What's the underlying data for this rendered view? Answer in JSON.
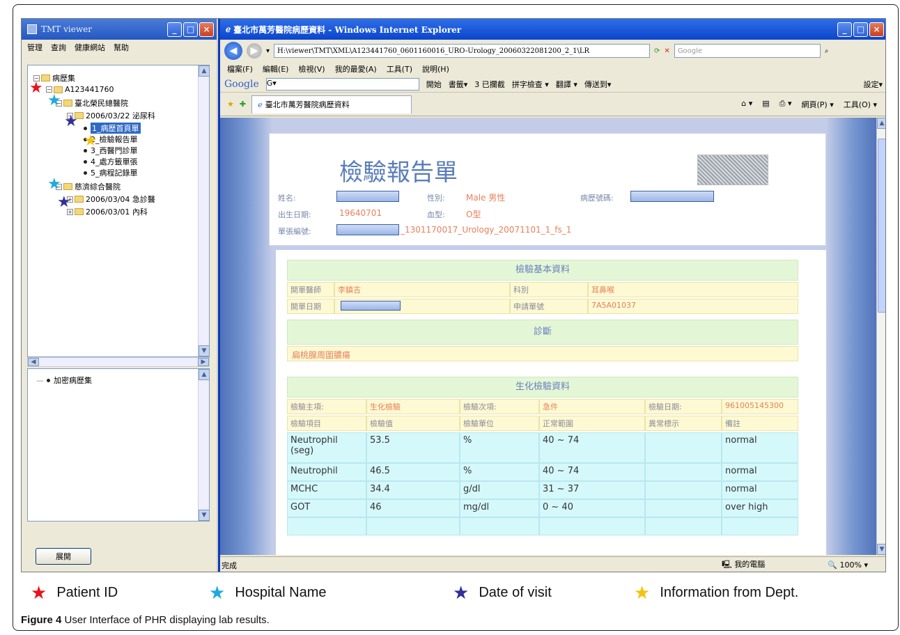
{
  "tmt": {
    "title": "TMT viewer",
    "menu": [
      "管理",
      "查詢",
      "健康網站",
      "幫助"
    ],
    "tree": {
      "root": "病歷集",
      "patient": "A123441760",
      "hospital1": "臺北榮民總醫院",
      "visit1": "2006/03/22 泌尿科",
      "docs": [
        "1_病歷首頁單",
        "2_檢驗報告單",
        "3_西醫門診單",
        "4_處方籤單張",
        "5_病程記錄單"
      ],
      "hospital2": "慈濟綜合醫院",
      "visit2": "2006/03/04 急診醫",
      "visit3": "2006/03/01 內科"
    },
    "lower_item": "加密病歷集",
    "expand_button": "展開"
  },
  "ie": {
    "title": "臺北市萬芳醫院病歷資料 - Windows Internet Explorer",
    "address": "H:\\viewer\\TMT\\XML\\A123441760_0601160016_URO-Urology_20060322081200_2_1\\LR",
    "search_placeholder": "Google",
    "menu": [
      "檔案(F)",
      "編輯(E)",
      "檢視(V)",
      "我的最愛(A)",
      "工具(T)",
      "說明(H)"
    ],
    "google_bar": {
      "logo": "Google",
      "g_box": "G▾",
      "items": [
        "開始",
        "書籤▾",
        "3 已攔截",
        "拼字檢查 ▾",
        "翻譯 ▾",
        "傳送到▾",
        "設定▾"
      ]
    },
    "tab_label": "臺北市萬芳醫院病歷資料",
    "tools": [
      "網頁(P) ▾",
      "工具(O) ▾"
    ],
    "status_left": "完成",
    "status_zone": "我的電腦",
    "status_zoom": "100%"
  },
  "report": {
    "title": "檢驗報告單",
    "fields": {
      "name_label": "姓名:",
      "sex_label": "性別:",
      "sex_value": "Male 男性",
      "chart_label": "病歷號碼:",
      "birth_label": "出生日期:",
      "birth_value": "19640701",
      "blood_label": "血型:",
      "blood_value": "O型",
      "form_label": "單張編號:",
      "form_value": "_1301170017_Urology_20071101_1_fs_1"
    },
    "basic": {
      "header": "檢驗基本資料",
      "doctor_label": "開單醫師",
      "doctor_value": "李鎮吉",
      "dept_label": "科別",
      "dept_value": "耳鼻喉",
      "date_label": "開單日期",
      "apply_label": "申請單號",
      "apply_value": "7A5A01037"
    },
    "diagnosis": {
      "header": "診斷",
      "value": "扁桃腺周圍膿瘍"
    },
    "bio": {
      "header": "生化檢驗資料",
      "meta": [
        "檢驗主項:",
        "生化檢驗",
        "檢驗次項:",
        "急件",
        "檢驗日期:",
        "961005145300"
      ],
      "columns": [
        "檢驗項目",
        "檢驗值",
        "檢驗單位",
        "正常範圍",
        "異常標示",
        "備註"
      ],
      "rows": [
        [
          "Neutrophil (seg)",
          "53.5",
          "%",
          "40 ~ 74",
          "",
          "normal"
        ],
        [
          "Neutrophil",
          "46.5",
          "%",
          "40 ~ 74",
          "",
          "normal"
        ],
        [
          "MCHC",
          "34.4",
          "g/dl",
          "31 ~ 37",
          "",
          "normal"
        ],
        [
          "GOT",
          "46",
          "mg/dl",
          "0 ~ 40",
          "",
          "over high"
        ],
        [
          "",
          "",
          "",
          "",
          "",
          ""
        ]
      ]
    }
  },
  "legend": [
    {
      "label": "Patient ID",
      "color": "#e8141c"
    },
    {
      "label": "Hospital Name",
      "color": "#1ea9e1"
    },
    {
      "label": "Date of visit",
      "color": "#31309a"
    },
    {
      "label": "Information from Dept.",
      "color": "#f4c20d"
    }
  ],
  "caption": {
    "label": "Figure 4",
    "text": "User Interface of PHR displaying lab results."
  }
}
